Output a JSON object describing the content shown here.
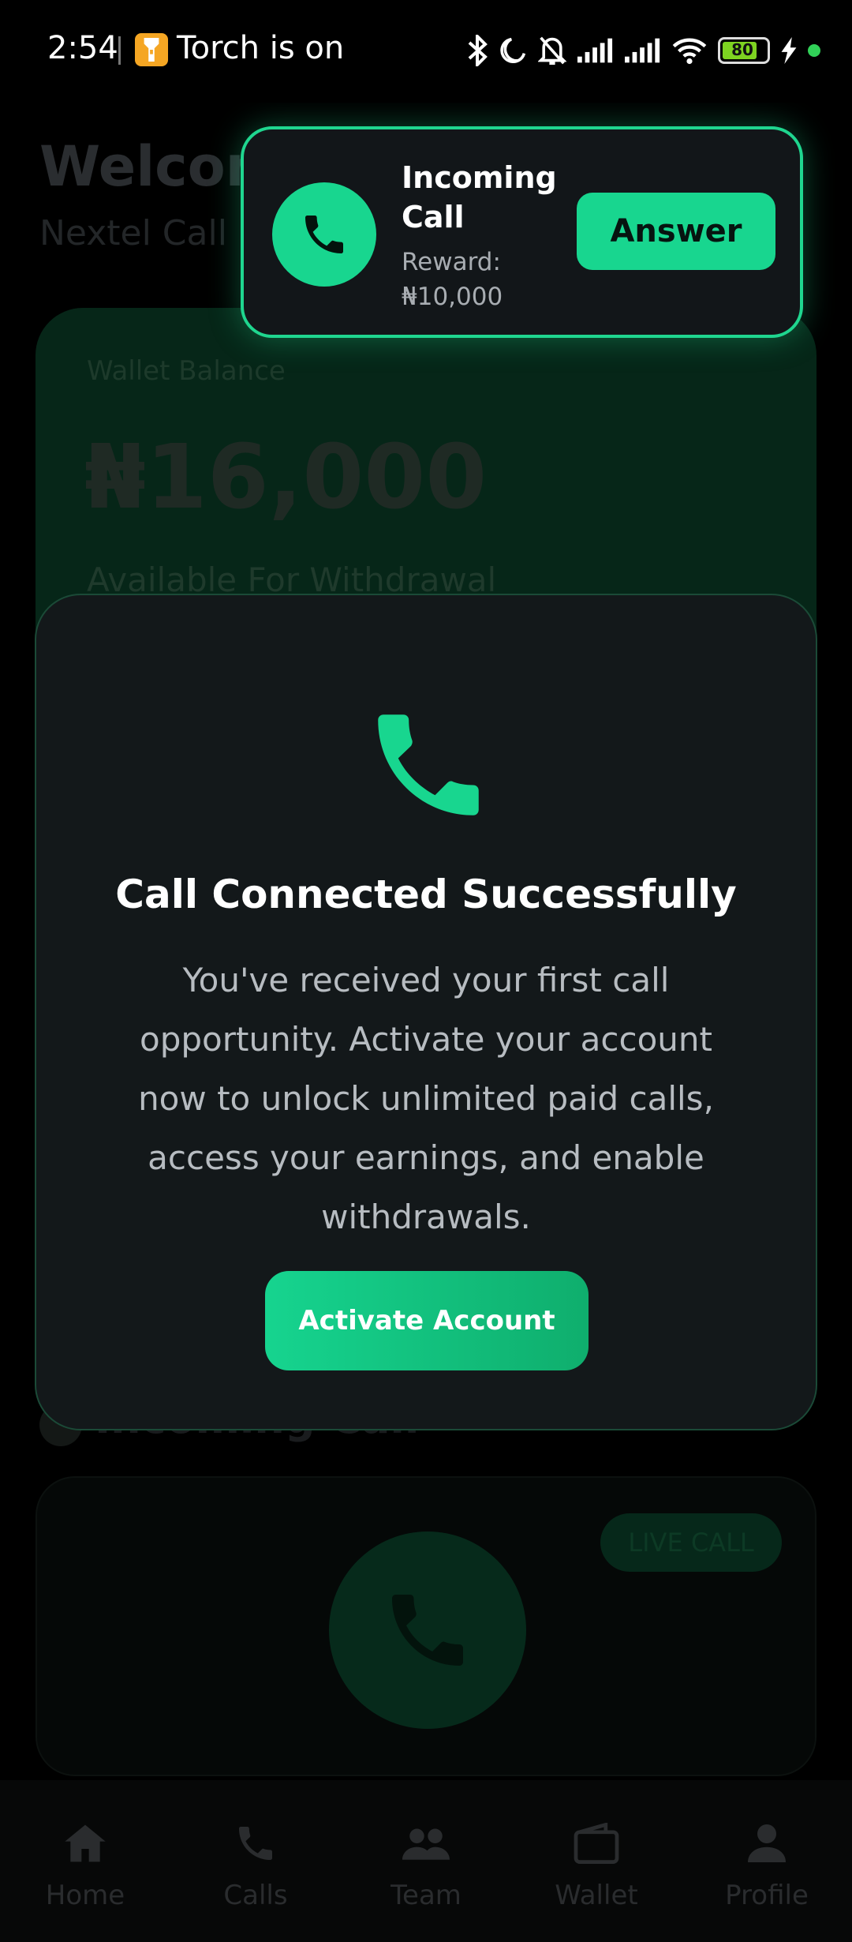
{
  "status_bar": {
    "time": "2:54",
    "torch_text": "Torch is on",
    "battery_level": "80",
    "icons": [
      "bluetooth-icon",
      "moon-icon",
      "bell-off-icon",
      "signal-icon",
      "signal-icon",
      "wifi-icon",
      "battery-icon",
      "charging-icon"
    ]
  },
  "background": {
    "welcome_title": "Welcom",
    "welcome_subtitle": "Nextel Call E",
    "wallet": {
      "label": "Wallet Balance",
      "amount": "₦16,000",
      "available": "Available For Withdrawal"
    },
    "incoming_section_title": "Incoming Call",
    "live_badge": "LIVE CALL"
  },
  "notification": {
    "title": "Incoming Call",
    "reward": "Reward: ₦10,000",
    "answer_label": "Answer",
    "accent_color": "#1fd68f"
  },
  "modal": {
    "title": "Call Connected Successfully",
    "body": "You've received your first call opportunity. Activate your account now to unlock unlimited paid calls, access your earnings, and enable withdrawals.",
    "button_label": "Activate Account"
  },
  "bottom_nav": {
    "items": [
      {
        "label": "Home",
        "icon": "home-icon"
      },
      {
        "label": "Calls",
        "icon": "phone-icon"
      },
      {
        "label": "Team",
        "icon": "team-icon"
      },
      {
        "label": "Wallet",
        "icon": "wallet-icon"
      },
      {
        "label": "Profile",
        "icon": "profile-icon"
      }
    ]
  }
}
